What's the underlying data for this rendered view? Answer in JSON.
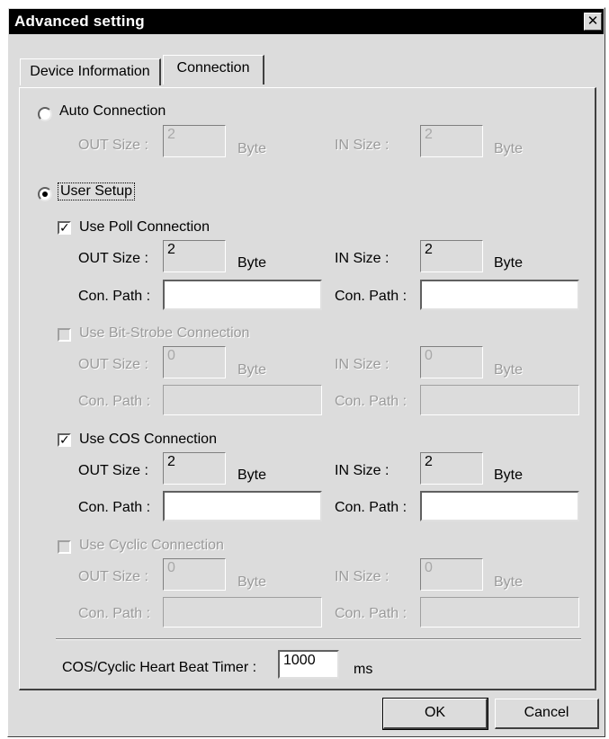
{
  "window": {
    "title": "Advanced setting",
    "close_glyph": "✕"
  },
  "tabs": [
    {
      "label": "Device Information",
      "active": false
    },
    {
      "label": "Connection",
      "active": true
    }
  ],
  "auto_connection": {
    "label": "Auto Connection",
    "selected": false,
    "out_label": "OUT Size :",
    "out_value": "2",
    "in_label": "IN Size :",
    "in_value": "2",
    "unit": "Byte"
  },
  "user_setup": {
    "label": "User Setup",
    "selected": true
  },
  "poll": {
    "label": "Use Poll Connection",
    "checked": true,
    "out_label": "OUT Size :",
    "out_value": "2",
    "in_label": "IN Size :",
    "in_value": "2",
    "unit": "Byte",
    "path_label": "Con. Path :",
    "out_path": "",
    "in_path": ""
  },
  "bitstrobe": {
    "label": "Use Bit-Strobe Connection",
    "checked": false,
    "out_label": "OUT Size :",
    "out_value": "0",
    "in_label": "IN Size :",
    "in_value": "0",
    "unit": "Byte",
    "path_label": "Con. Path :",
    "out_path": "",
    "in_path": ""
  },
  "cos": {
    "label": "Use COS Connection",
    "checked": true,
    "out_label": "OUT Size :",
    "out_value": "2",
    "in_label": "IN Size :",
    "in_value": "2",
    "unit": "Byte",
    "path_label": "Con. Path :",
    "out_path": "",
    "in_path": ""
  },
  "cyclic": {
    "label": "Use Cyclic Connection",
    "checked": false,
    "out_label": "OUT Size :",
    "out_value": "0",
    "in_label": "IN Size :",
    "in_value": "0",
    "unit": "Byte",
    "path_label": "Con. Path :",
    "out_path": "",
    "in_path": ""
  },
  "heartbeat": {
    "label": "COS/Cyclic Heart Beat Timer :",
    "value": "1000",
    "unit": "ms"
  },
  "buttons": {
    "ok": "OK",
    "cancel": "Cancel"
  },
  "icons": {
    "check": "check-mark-icon",
    "radio": "radio-dot-icon",
    "close": "close-icon"
  }
}
